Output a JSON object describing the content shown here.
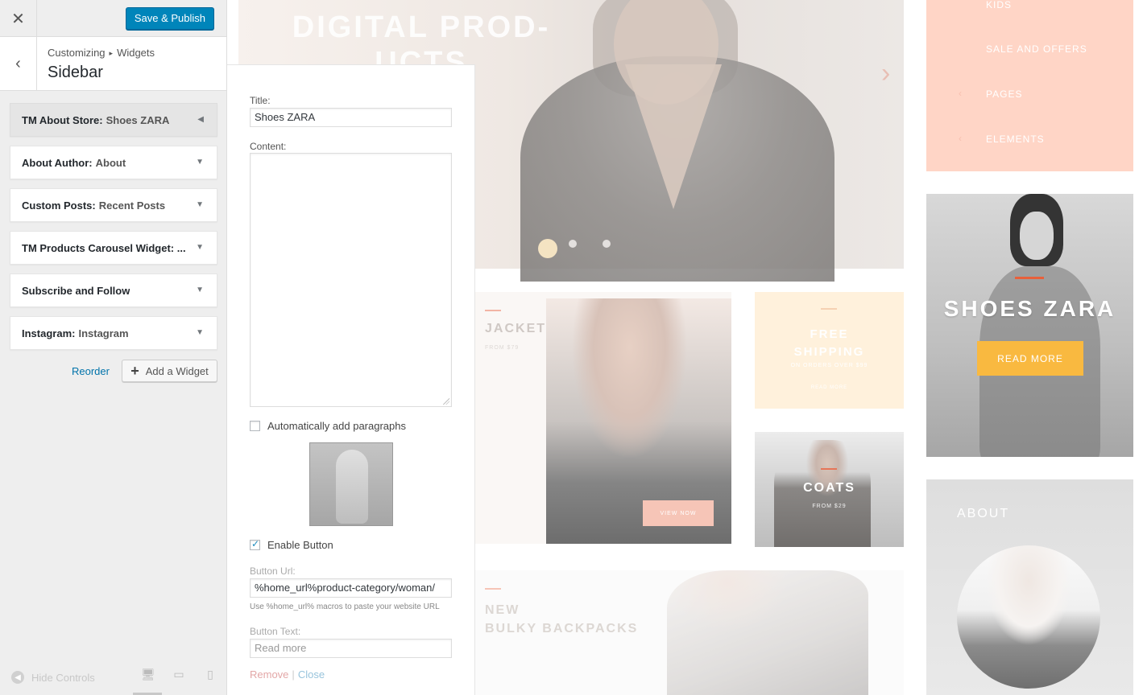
{
  "customizer": {
    "publish_label": "Save & Publish",
    "breadcrumb": [
      "Customizing",
      "Widgets"
    ],
    "breadcrumb_sep": "▸",
    "section_title": "Sidebar",
    "widgets": [
      {
        "name": "TM About Store:",
        "sub": "Shoes ZARA",
        "open": true
      },
      {
        "name": "About Author:",
        "sub": "About",
        "open": false
      },
      {
        "name": "Custom Posts:",
        "sub": "Recent Posts",
        "open": false
      },
      {
        "name": "TM Products Carousel Widget: ...",
        "sub": "",
        "open": false
      },
      {
        "name": "Subscribe and Follow",
        "sub": "",
        "open": false
      },
      {
        "name": "Instagram:",
        "sub": "Instagram",
        "open": false
      }
    ],
    "reorder_label": "Reorder",
    "add_widget_label": "Add a Widget",
    "hide_controls_label": "Hide Controls"
  },
  "widget_form": {
    "title_label": "Title:",
    "title_value": "Shoes ZARA",
    "content_label": "Content:",
    "content_value": "",
    "auto_paragraphs_label": "Automatically add paragraphs",
    "auto_paragraphs_checked": false,
    "enable_button_label": "Enable Button",
    "enable_button_checked": true,
    "button_url_label": "Button Url:",
    "button_url_value": "%home_url%product-category/woman/",
    "button_url_help": "Use %home_url% macros to paste your website URL",
    "button_text_label": "Button Text:",
    "button_text_placeholder": "Read more",
    "remove_label": "Remove",
    "close_label": "Close"
  },
  "preview": {
    "slider_heading": "DIGITAL PROD-\nUCTS",
    "jacket_title": "JACKET",
    "jacket_price": "FROM $79",
    "jacket_button": "VIEW NOW",
    "shipping_title": "FREE\nSHIPPING",
    "shipping_sub": "ON ORDERS OVER $99",
    "shipping_link": "READ MORE",
    "coats_title": "COATS",
    "coats_price": "FROM $29",
    "backpack_title": "NEW\nBULKY BACKPACKS",
    "menu_items": [
      "KIDS",
      "SALE AND OFFERS",
      "PAGES",
      "ELEMENTS"
    ],
    "shoes_title": "SHOES ZARA",
    "shoes_button": "READ MORE",
    "about_title": "ABOUT"
  },
  "colors": {
    "publish": "#0085ba",
    "link": "#0073aa",
    "menu_bg": "#ffd5c6",
    "shoes_button": "#f9b940",
    "accent_bar": "#e8603b"
  }
}
